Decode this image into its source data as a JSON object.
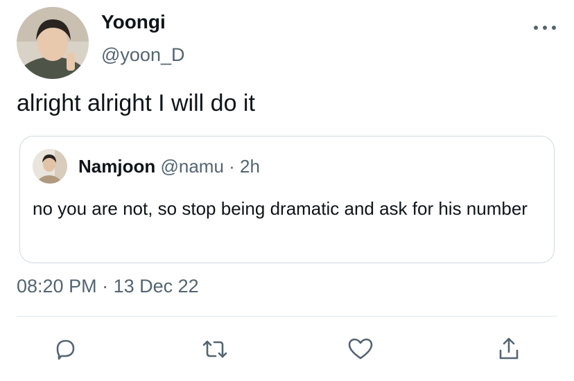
{
  "tweet": {
    "author": {
      "display_name": "Yoongi",
      "handle": "@yoon_D",
      "avatar_icon": "user-photo-avatar"
    },
    "text": "alright alright I will do it",
    "quote": {
      "author_name": "Namjoon",
      "author_handle": "@namu",
      "separator": "·",
      "time_ago": "2h",
      "avatar_icon": "user-photo-avatar",
      "text": "no you are not, so stop being dramatic and ask for his number"
    },
    "timestamp": {
      "time": "08:20 PM",
      "separator": "·",
      "date": "13 Dec 22"
    },
    "actions": [
      {
        "name": "reply",
        "icon": "reply-icon"
      },
      {
        "name": "retweet",
        "icon": "retweet-icon"
      },
      {
        "name": "like",
        "icon": "heart-icon"
      },
      {
        "name": "share",
        "icon": "share-icon"
      }
    ],
    "colors": {
      "text_primary": "#0f1419",
      "text_secondary": "#536471",
      "border": "#cfd9de"
    }
  }
}
